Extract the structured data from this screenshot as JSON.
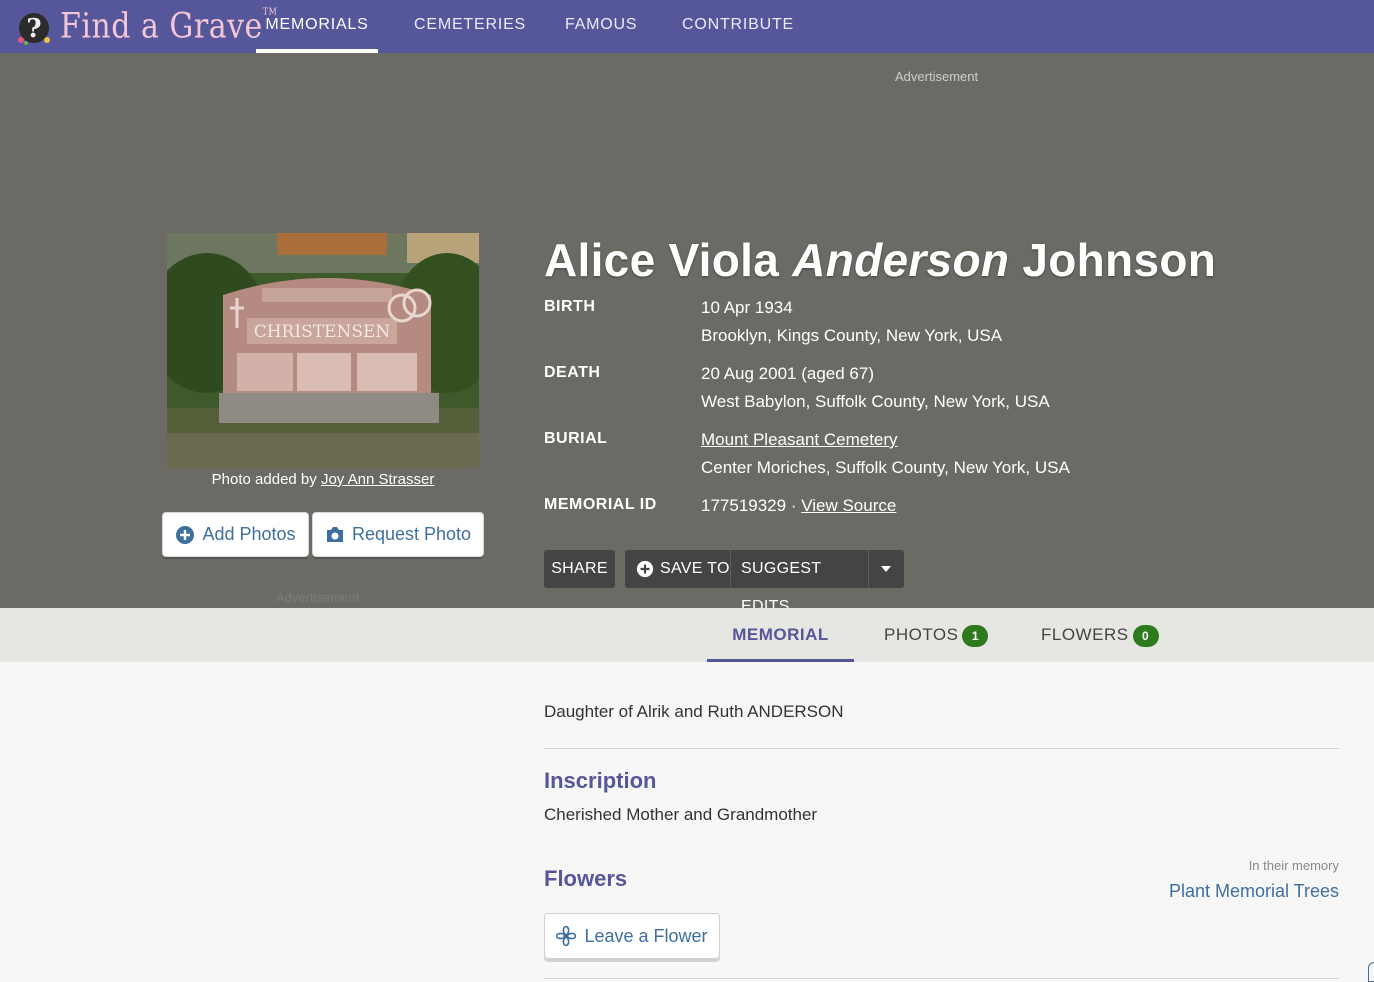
{
  "nav": {
    "logo_text": "Find a Grave",
    "logo_tm": "TM",
    "items": [
      "MEMORIALS",
      "CEMETERIES",
      "FAMOUS",
      "CONTRIBUTE"
    ]
  },
  "hero": {
    "advertisement": "Advertisement",
    "photo_caption_prefix": "Photo added by ",
    "photo_contributor": "Joy Ann Strasser",
    "headstone_text": "CHRISTENSEN",
    "add_photos": "Add Photos",
    "request_photo": "Request Photo",
    "advertisement_left": "Advertisement",
    "name_first": "Alice Viola ",
    "name_maiden": "Anderson",
    "name_last": " Johnson",
    "birth_label": "BIRTH",
    "birth_date": "10 Apr 1934",
    "birth_place": "Brooklyn, Kings County, New York, USA",
    "death_label": "DEATH",
    "death_date": "20 Aug 2001 (aged 67)",
    "death_place": "West Babylon, Suffolk County, New York, USA",
    "burial_label": "BURIAL",
    "burial_cemetery": "Mount Pleasant Cemetery",
    "burial_place": "Center Moriches, Suffolk County, New York, USA",
    "memorial_id_label": "MEMORIAL ID",
    "memorial_id": "177519329",
    "separator": " · ",
    "view_source": "View Source",
    "share": "SHARE",
    "save_to": "SAVE TO",
    "suggest_edits": "SUGGEST EDITS"
  },
  "tabs": {
    "memorial": "MEMORIAL",
    "photos": "PHOTOS",
    "photos_count": "1",
    "flowers": "FLOWERS",
    "flowers_count": "0"
  },
  "content": {
    "bio": "Daughter of Alrik and Ruth ANDERSON",
    "inscription_heading": "Inscription",
    "inscription": "Cherished Mother and Grandmother",
    "flowers_heading": "Flowers",
    "in_their_memory": "In their memory",
    "plant_trees": "Plant Memorial Trees",
    "leave_flower": "Leave a Flower"
  },
  "colors": {
    "nav_bg": "#56579a",
    "hero_bg": "#6b6a65",
    "accent": "#56579a",
    "link": "#3e6f9f",
    "badge": "#2f7a1e"
  }
}
